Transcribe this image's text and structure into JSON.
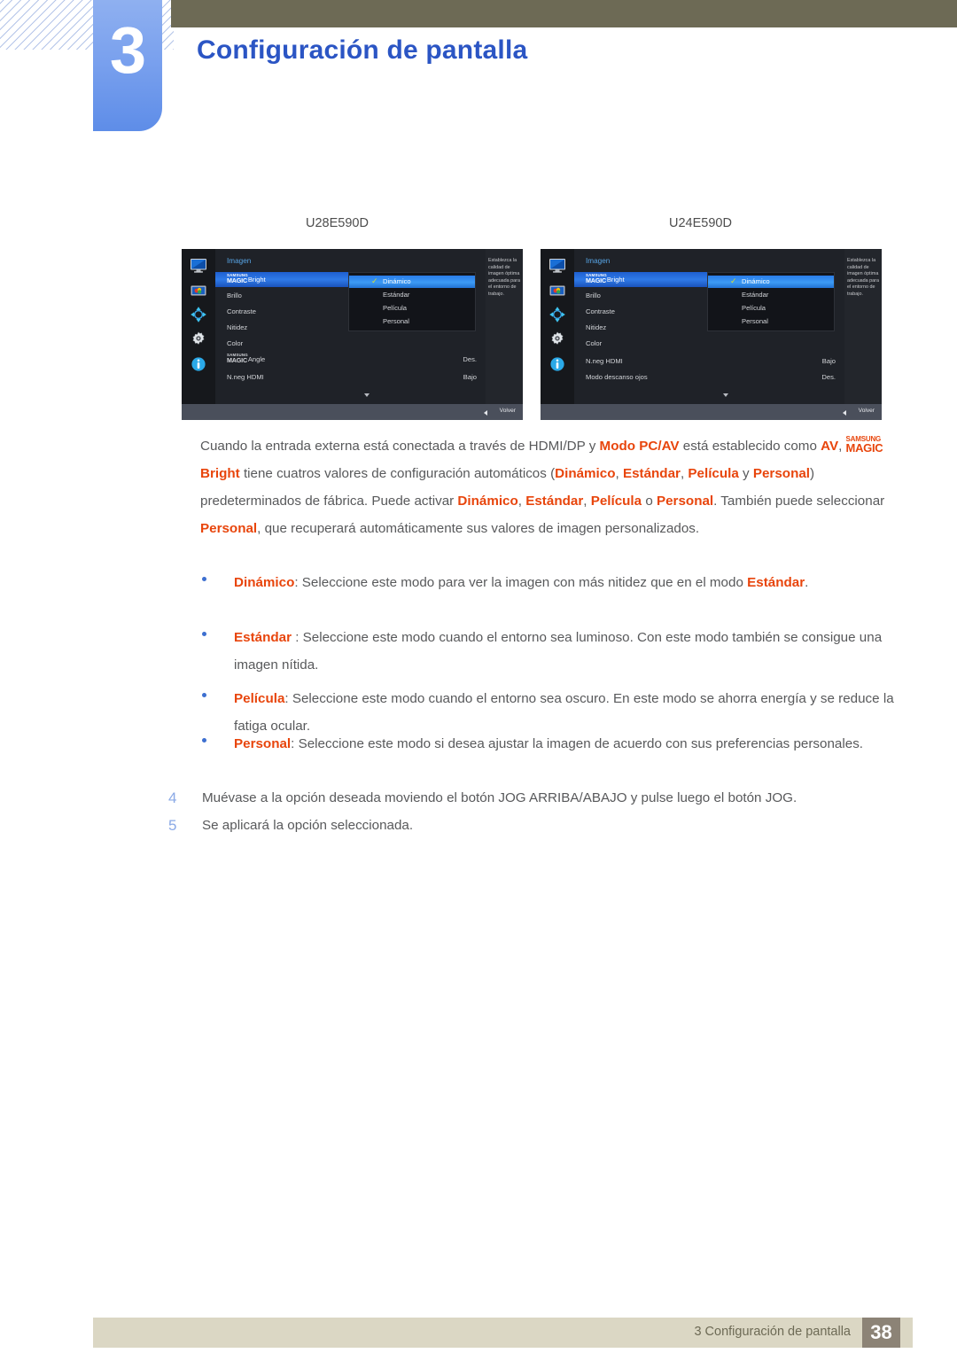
{
  "header": {
    "chapter_number": "3",
    "chapter_title": "Configuración de pantalla"
  },
  "models": {
    "left": "U28E590D",
    "right": "U24E590D"
  },
  "osd_left": {
    "menu_title": "Imagen",
    "description": "Establezca la calidad de imagen óptima adecuada para el entorno de trabajo.",
    "rows": [
      {
        "label_small": "SAMSUNG",
        "label_big": "MAGIC",
        "label_tail": "Bright",
        "value": ""
      },
      {
        "label_tail": "Brillo",
        "value": ""
      },
      {
        "label_tail": "Contraste",
        "value": ""
      },
      {
        "label_tail": "Nitidez",
        "value": ""
      },
      {
        "label_tail": "Color",
        "value": ""
      },
      {
        "label_small": "SAMSUNG",
        "label_big": "MAGIC",
        "label_tail": "Angle",
        "value": "Des."
      },
      {
        "label_tail": "N.neg HDMI",
        "value": "Bajo"
      }
    ],
    "submenu": [
      "Dinámico",
      "Estándar",
      "Película",
      "Personal"
    ],
    "selected": "Dinámico",
    "back_label": "Volver"
  },
  "osd_right": {
    "menu_title": "Imagen",
    "description": "Establezca la calidad de imagen óptima adecuada para el entorno de trabajo.",
    "rows": [
      {
        "label_small": "SAMSUNG",
        "label_big": "MAGIC",
        "label_tail": "Bright",
        "value": ""
      },
      {
        "label_tail": "Brillo",
        "value": ""
      },
      {
        "label_tail": "Contraste",
        "value": ""
      },
      {
        "label_tail": "Nitidez",
        "value": ""
      },
      {
        "label_tail": "Color",
        "value": ""
      },
      {
        "label_tail": "N.neg HDMI",
        "value": "Bajo"
      },
      {
        "label_tail": "Modo descanso ojos",
        "value": "Des."
      }
    ],
    "submenu": [
      "Dinámico",
      "Estándar",
      "Película",
      "Personal"
    ],
    "selected": "Dinámico",
    "back_label": "Volver"
  },
  "body": {
    "intro": {
      "t1": "Cuando la entrada externa está conectada a través de HDMI/DP y ",
      "h1": "Modo PC/AV",
      "t2": " está establecido como ",
      "h2": "AV",
      "t3": ", ",
      "magic_small": "SAMSUNG",
      "magic_big": "MAGIC",
      "magic_tail": "Bright",
      "t4": " tiene cuatros valores de configuración automáticos (",
      "h3": "Dinámico",
      "t5": ", ",
      "h4": "Estándar",
      "t6": ", ",
      "h5": "Película",
      "t7": " y ",
      "h6": "Personal",
      "t8": ") predeterminados de fábrica. Puede activar ",
      "h7": "Dinámico",
      "t9": ", ",
      "h8": "Estándar",
      "t10": ", ",
      "h9": "Película",
      "t11": " o ",
      "h10": "Personal",
      "t12": ". También puede seleccionar ",
      "h11": "Personal",
      "t13": ", que recuperará automáticamente sus valores de imagen personalizados."
    },
    "bullets": [
      {
        "term": "Dinámico",
        "t1": ": Seleccione este modo para ver la imagen con más nitidez que en el modo ",
        "term2": "Estándar",
        "t2": "."
      },
      {
        "term": "Estándar",
        "t1": " : Seleccione este modo cuando el entorno sea luminoso. Con este modo también se consigue una imagen nítida.",
        "term2": "",
        "t2": ""
      },
      {
        "term": "Película",
        "t1": ": Seleccione este modo cuando el entorno sea oscuro. En este modo se ahorra energía y se reduce la fatiga ocular.",
        "term2": "",
        "t2": ""
      },
      {
        "term": "Personal",
        "t1": ": Seleccione este modo si desea ajustar la imagen de acuerdo con sus preferencias personales.",
        "term2": "",
        "t2": ""
      }
    ],
    "steps": [
      {
        "num": "4",
        "text": "Muévase a la opción deseada moviendo el botón JOG ARRIBA/ABAJO y pulse luego el botón JOG."
      },
      {
        "num": "5",
        "text": "Se aplicará la opción seleccionada."
      }
    ]
  },
  "footer": {
    "text": "3 Configuración de pantalla",
    "page": "38"
  },
  "colors": {
    "accent_orange": "#e8450c",
    "title_blue": "#2b55c4",
    "chapter_blue": "#7aa1ee",
    "olive": "#6d6a55",
    "footer_bar": "#dbd7c4",
    "page_box": "#8c8376"
  }
}
